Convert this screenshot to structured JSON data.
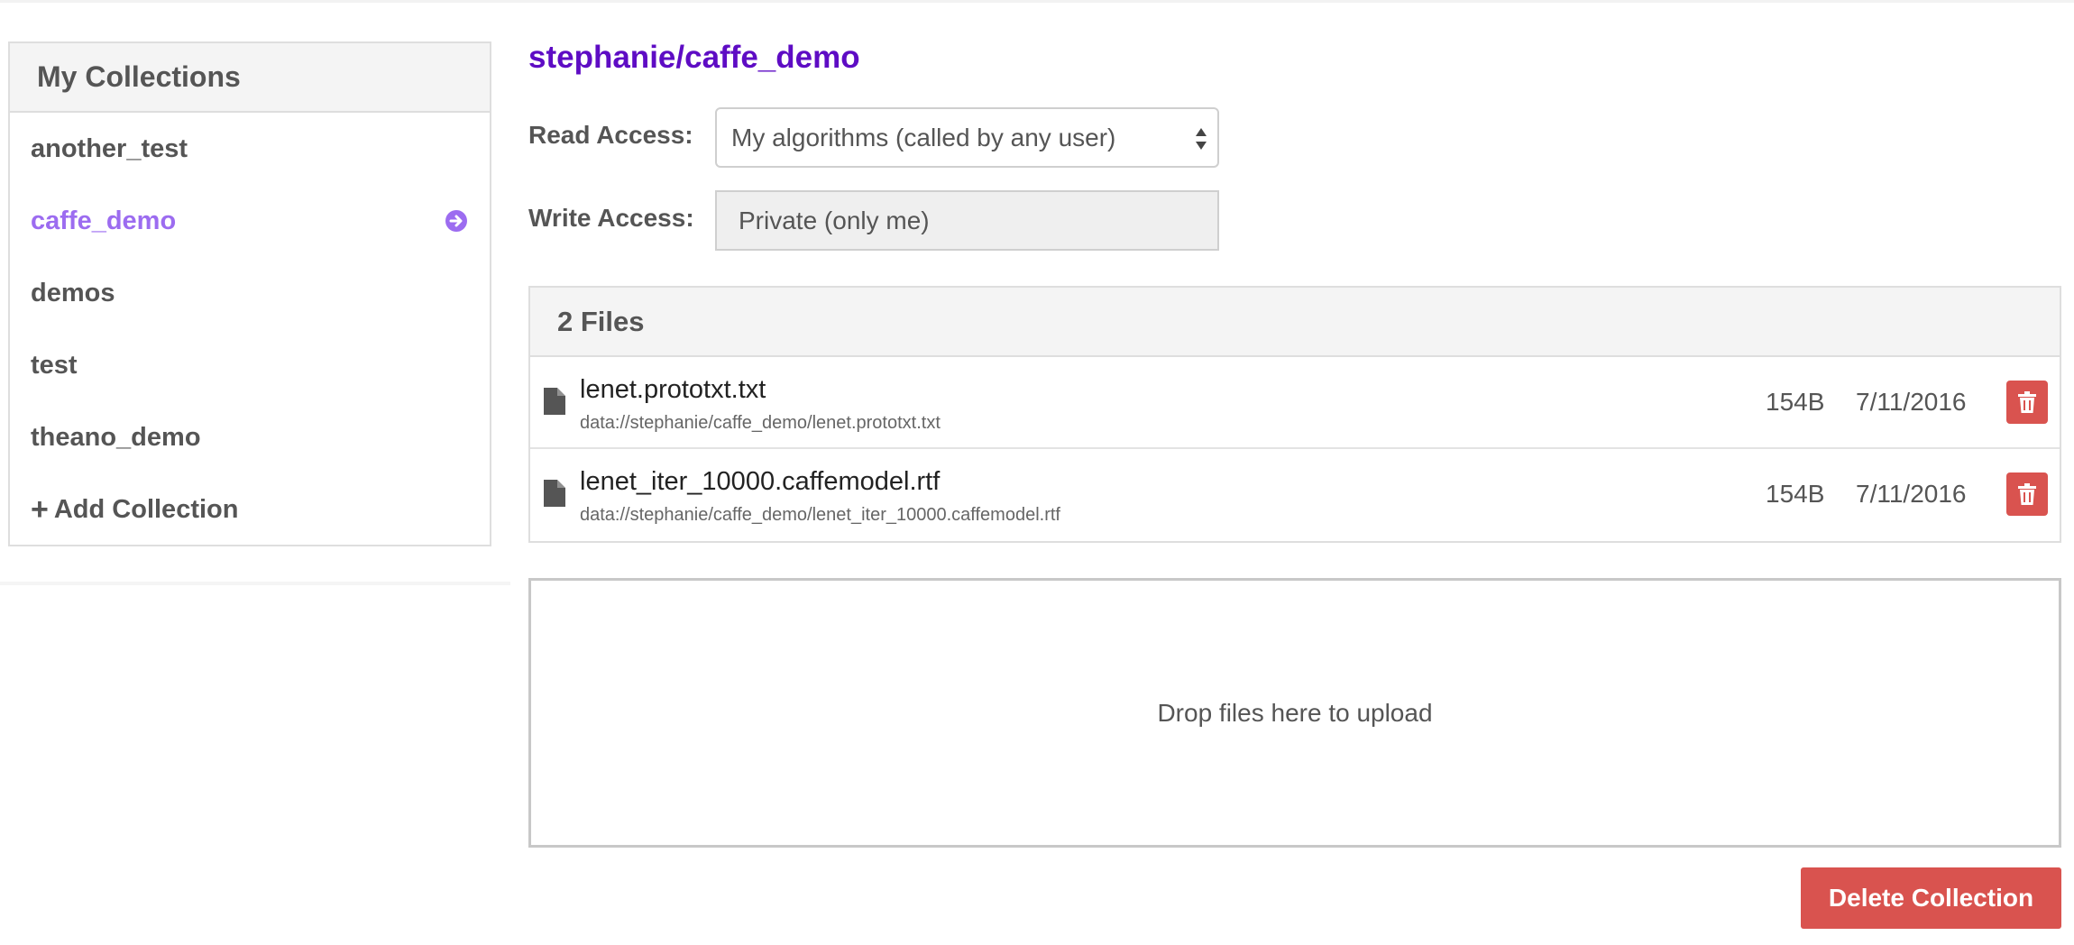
{
  "sidebar": {
    "title": "My Collections",
    "items": [
      {
        "label": "another_test",
        "active": false
      },
      {
        "label": "caffe_demo",
        "active": true
      },
      {
        "label": "demos",
        "active": false
      },
      {
        "label": "test",
        "active": false
      },
      {
        "label": "theano_demo",
        "active": false
      }
    ],
    "add_label": "Add Collection",
    "add_icon": "plus-icon",
    "active_icon": "arrow-circle-right-icon"
  },
  "main": {
    "title": "stephanie/caffe_demo",
    "read_access": {
      "label": "Read Access:",
      "value": "My algorithms (called by any user)"
    },
    "write_access": {
      "label": "Write Access:",
      "value": "Private (only me)"
    },
    "files": {
      "header": "2 Files",
      "rows": [
        {
          "name": "lenet.prototxt.txt",
          "path": "data://stephanie/caffe_demo/lenet.prototxt.txt",
          "size": "154B",
          "date": "7/11/2016"
        },
        {
          "name": "lenet_iter_10000.caffemodel.rtf",
          "path": "data://stephanie/caffe_demo/lenet_iter_10000.caffemodel.rtf",
          "size": "154B",
          "date": "7/11/2016"
        }
      ]
    },
    "dropzone_text": "Drop files here to upload",
    "delete_label": "Delete Collection"
  },
  "colors": {
    "accent": "#5e0cc4",
    "active_item": "#9c6cf0",
    "danger": "#d9534f",
    "text": "#555555"
  }
}
